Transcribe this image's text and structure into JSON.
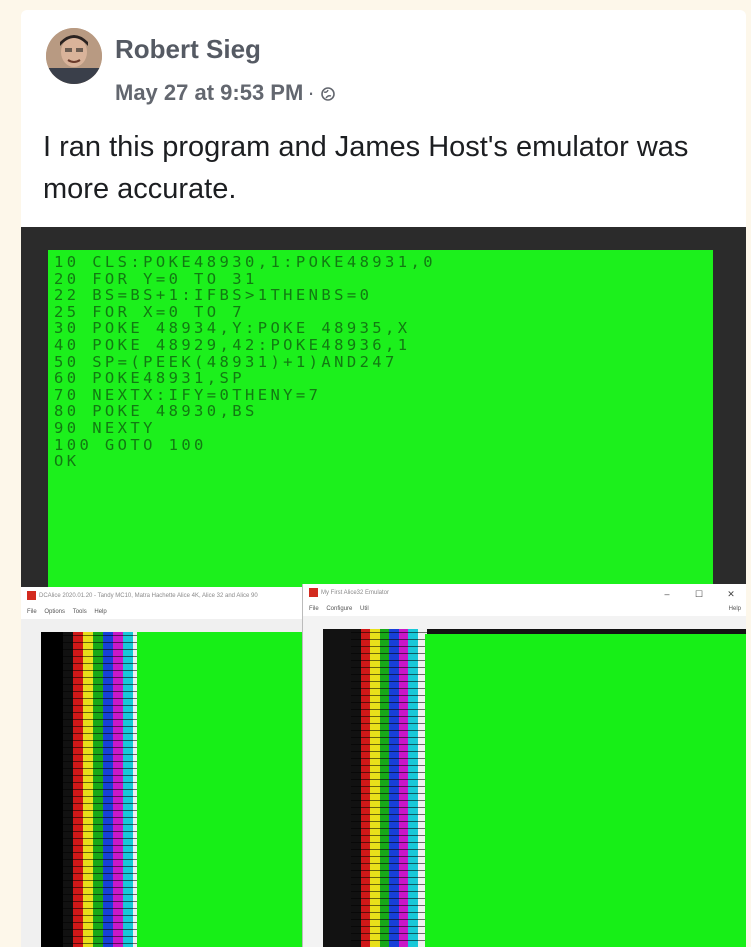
{
  "post": {
    "author": "Robert Sieg",
    "timestamp": "May 27 at 9:53 PM",
    "separator": "·",
    "visibility_icon": "globe-icon",
    "text": "I ran this program and James Host's emulator was more accurate."
  },
  "basic_screen": {
    "lines": [
      "10 CLS:POKE48930,1:POKE48931,0",
      "20 FOR Y=0 TO 31",
      "22 BS=BS+1:IFBS>1THENBS=0",
      "25 FOR X=0 TO 7",
      "30 POKE 48934,Y:POKE 48935,X",
      "40 POKE 48929,42:POKE48936,1",
      "50 SP=(PEEK(48931)+1)AND247",
      "60 POKE48931,SP",
      "70 NEXTX:IFY=0THENY=7",
      "80 POKE 48930,BS",
      "90 NEXTY",
      "100 GOTO 100",
      "OK"
    ],
    "colors": {
      "background": "#1cf01c",
      "text": "#127a12"
    }
  },
  "left_window": {
    "title": "DCAlice 2020.01.20 - Tandy MC10, Matra Hachette Alice 4K, Alice 32 and Alice 90",
    "menu": [
      "File",
      "Options",
      "Tools",
      "Help"
    ]
  },
  "right_window": {
    "title": "My First Alice32 Emulator",
    "menu": [
      "File",
      "Configure",
      "Util"
    ],
    "help": "Help",
    "controls": [
      "–",
      "☐",
      "✕"
    ]
  },
  "stripe_colors": [
    "#111111",
    "#d01818",
    "#e8e01a",
    "#18a818",
    "#1840d8",
    "#c818c8",
    "#18c8d8",
    "#f0f0f0"
  ]
}
